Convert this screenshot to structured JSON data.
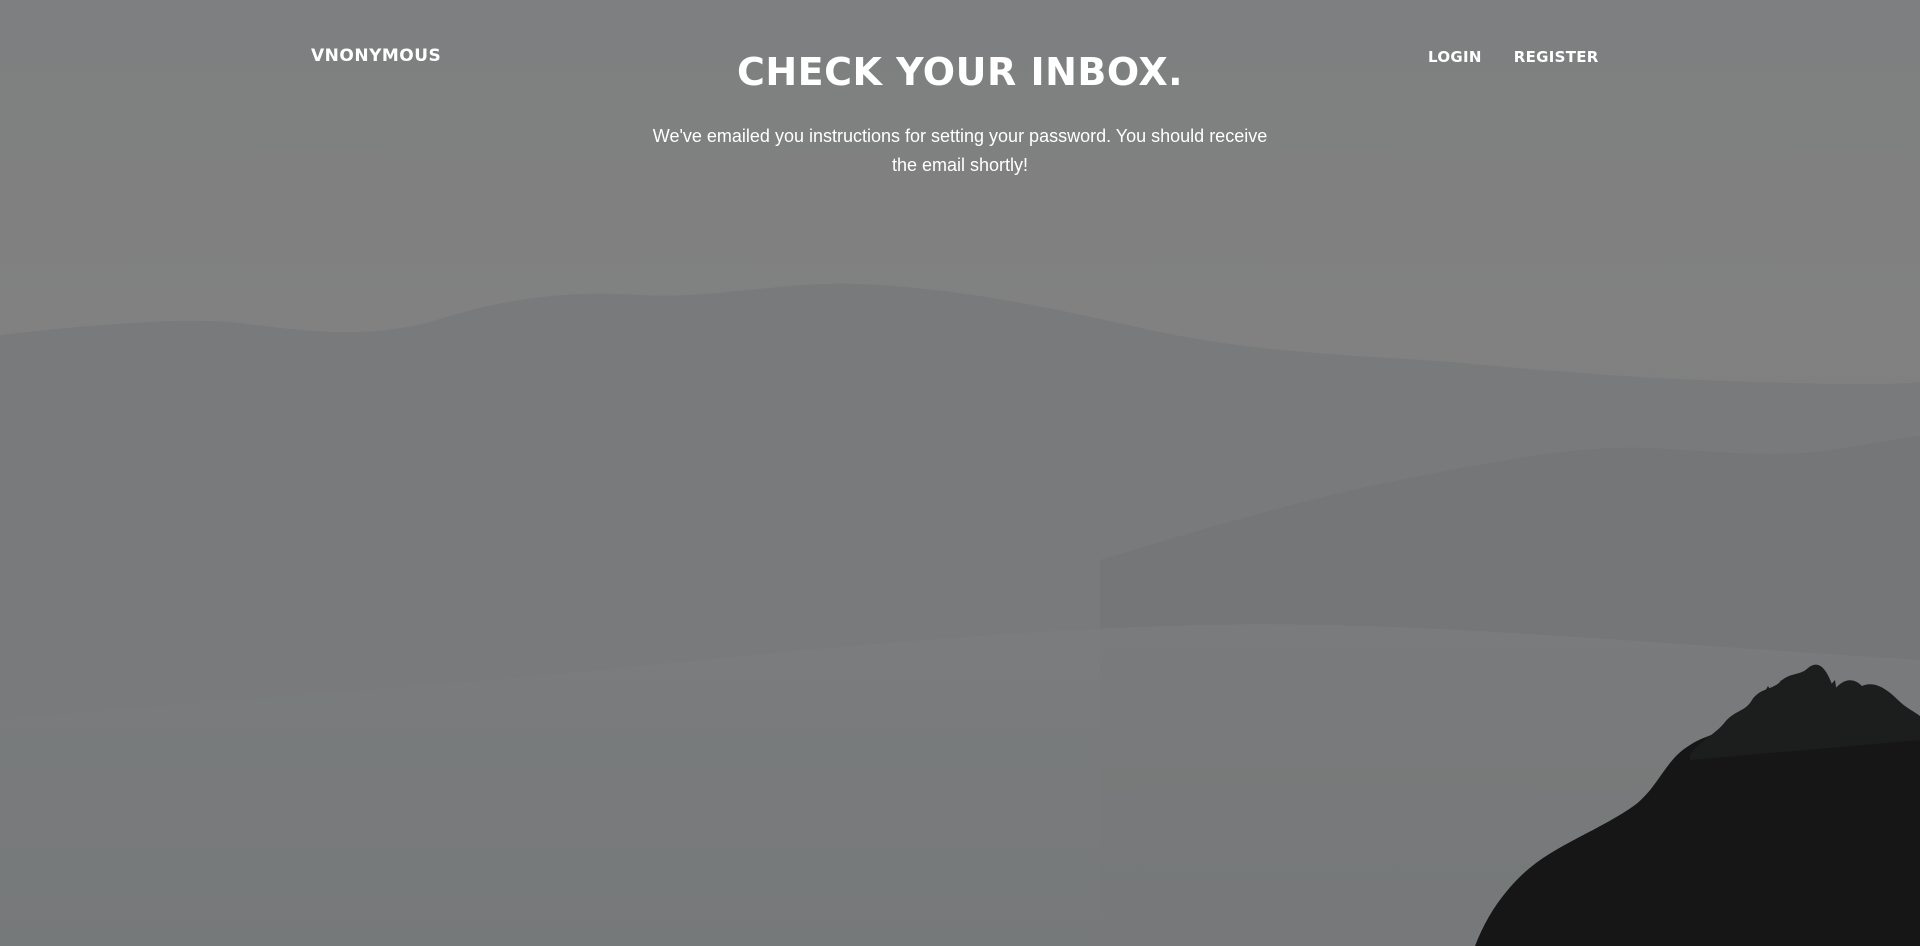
{
  "nav": {
    "brand": "VNONYMOUS",
    "links": [
      {
        "label": "LOGIN"
      },
      {
        "label": "REGISTER"
      }
    ]
  },
  "main": {
    "title": "CHECK YOUR INBOX.",
    "message": "We've emailed you instructions for setting your password. You should receive the email shortly!"
  },
  "background": {
    "image": "misty-mountains-grayscale",
    "overlay_color": "#7f7f7f"
  }
}
